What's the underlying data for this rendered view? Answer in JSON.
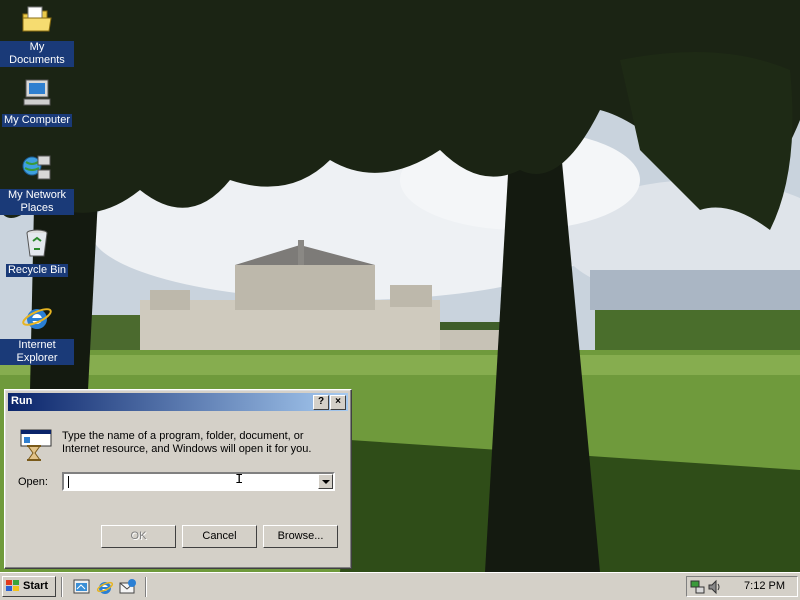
{
  "desktop": {
    "icons": [
      {
        "label": "My Documents",
        "icon": "folder-documents-icon"
      },
      {
        "label": "My Computer",
        "icon": "computer-icon"
      },
      {
        "label": "My Network Places",
        "icon": "network-places-icon"
      },
      {
        "label": "Recycle Bin",
        "icon": "recycle-bin-icon"
      },
      {
        "label": "Internet Explorer",
        "icon": "internet-explorer-icon"
      }
    ]
  },
  "run_dialog": {
    "title": "Run",
    "help_button": "?",
    "close_button": "×",
    "description": "Type the name of a program, folder, document, or Internet resource, and Windows will open it for you.",
    "open_label": "Open:",
    "open_value": "",
    "ok_label": "OK",
    "cancel_label": "Cancel",
    "browse_label": "Browse..."
  },
  "taskbar": {
    "start_label": "Start",
    "clock": "7:12 PM",
    "quick_launch": [
      "show-desktop-icon",
      "internet-explorer-icon",
      "outlook-express-icon"
    ]
  },
  "colors": {
    "titlebar_start": "#0a246a",
    "titlebar_end": "#a6caf0",
    "face": "#d4d0c8",
    "desktop_label_bg": "#1a3a78"
  }
}
